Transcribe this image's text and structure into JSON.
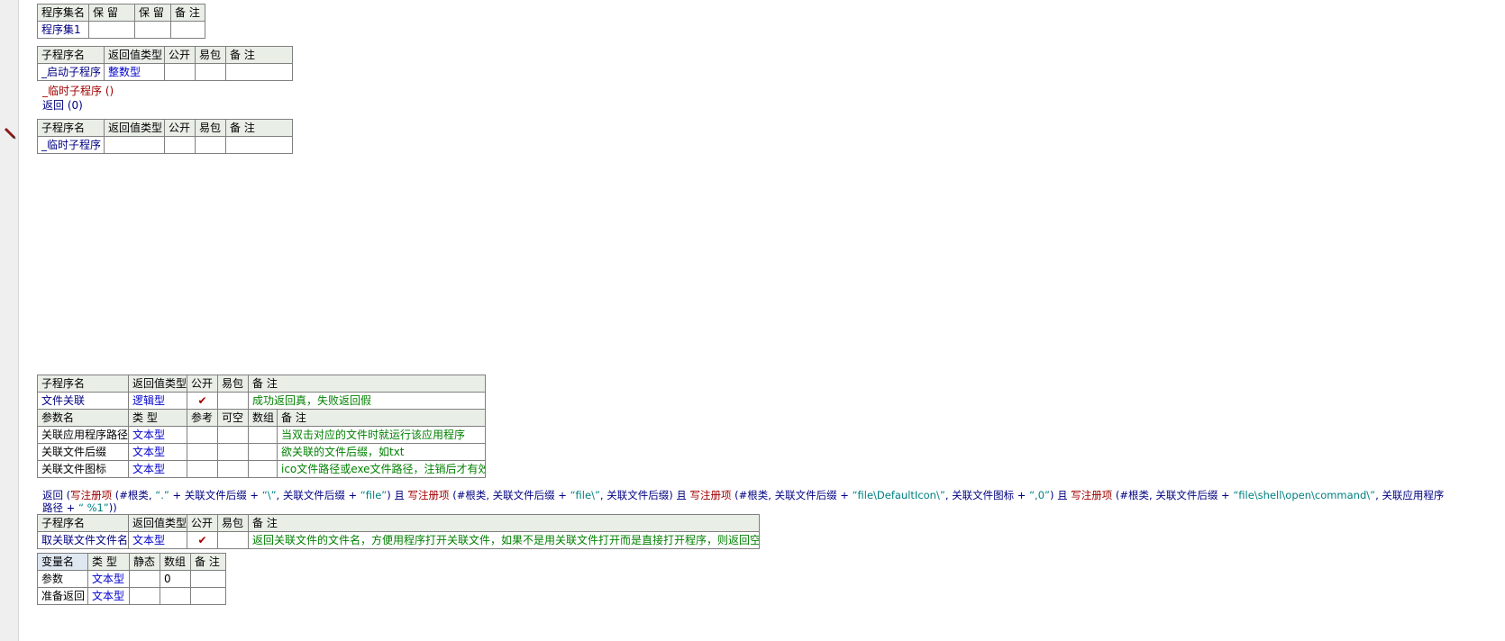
{
  "assembly_table": {
    "headers": [
      "程序集名",
      "保 留",
      "保 留",
      "备 注"
    ],
    "row": [
      "程序集1",
      "",
      "",
      ""
    ]
  },
  "sub1": {
    "headers": [
      "子程序名",
      "返回值类型",
      "公开",
      "易包",
      "备 注"
    ],
    "row": {
      "name": "_启动子程序",
      "type": "整数型",
      "public": "",
      "easy": "",
      "note": ""
    }
  },
  "code1": {
    "line1": "_临时子程序 ()",
    "line2_cmd": "返回",
    "line2_rest": " (0)"
  },
  "sub2": {
    "headers": [
      "子程序名",
      "返回值类型",
      "公开",
      "易包",
      "备 注"
    ],
    "row": {
      "name": "_临时子程序",
      "type": "",
      "public": "",
      "easy": "",
      "note": ""
    }
  },
  "sub3": {
    "headers": [
      "子程序名",
      "返回值类型",
      "公开",
      "易包",
      "备 注"
    ],
    "row": {
      "name": "文件关联",
      "type": "逻辑型",
      "public": "✔",
      "easy": "",
      "note": "成功返回真，失败返回假"
    },
    "param_headers": [
      "参数名",
      "类 型",
      "参考",
      "可空",
      "数组",
      "备 注"
    ],
    "params": [
      {
        "name": "关联应用程序路径",
        "type": "文本型",
        "note": "当双击对应的文件时就运行该应用程序"
      },
      {
        "name": "关联文件后缀",
        "type": "文本型",
        "note": "欲关联的文件后缀，如txt"
      },
      {
        "name": "关联文件图标",
        "type": "文本型",
        "note": "ico文件路径或exe文件路径，注销后才有效"
      }
    ]
  },
  "code3": {
    "t01": "返回 (",
    "t02": "写注册项",
    "t03": " (#根类, ",
    "t04": "“.”",
    "t05": " + 关联文件后缀 + ",
    "t06": "“\\”",
    "t07": ", 关联文件后缀 + ",
    "t08": "“file”",
    "t09": ") 且 ",
    "t10": "写注册项",
    "t11": " (#根类, 关联文件后缀 + ",
    "t12": "“file\\”",
    "t13": ", 关联文件后缀) 且 ",
    "t14": "写注册项",
    "t15": " (#根类, 关联文件后缀 + ",
    "t16": "“file\\DefaultIcon\\”",
    "t17": ", 关联文件图标 + ",
    "t18": "“,0”",
    "t19": ") 且 ",
    "t20": "写注册项",
    "t21": " (#根类, 关联文件后缀 + ",
    "t22": "“file\\shell\\open\\command\\”",
    "t23": ", 关联应用程序路径 + ",
    "t24": "“ %1”",
    "t25": "))"
  },
  "sub4": {
    "headers": [
      "子程序名",
      "返回值类型",
      "公开",
      "易包",
      "备 注"
    ],
    "row": {
      "name": "取关联文件文件名",
      "type": "文本型",
      "public": "✔",
      "easy": "",
      "note": "返回关联文件的文件名，方便用程序打开关联文件，如果不是用关联文件打开而是直接打开程序，则返回空文本"
    }
  },
  "vars": {
    "headers": [
      "变量名",
      "类 型",
      "静态",
      "数组",
      "备 注"
    ],
    "rows": [
      {
        "name": "参数",
        "type": "文本型",
        "static": "",
        "array": "0",
        "note": ""
      },
      {
        "name": "准备返回",
        "type": "文本型",
        "static": "",
        "array": "",
        "note": ""
      }
    ]
  }
}
